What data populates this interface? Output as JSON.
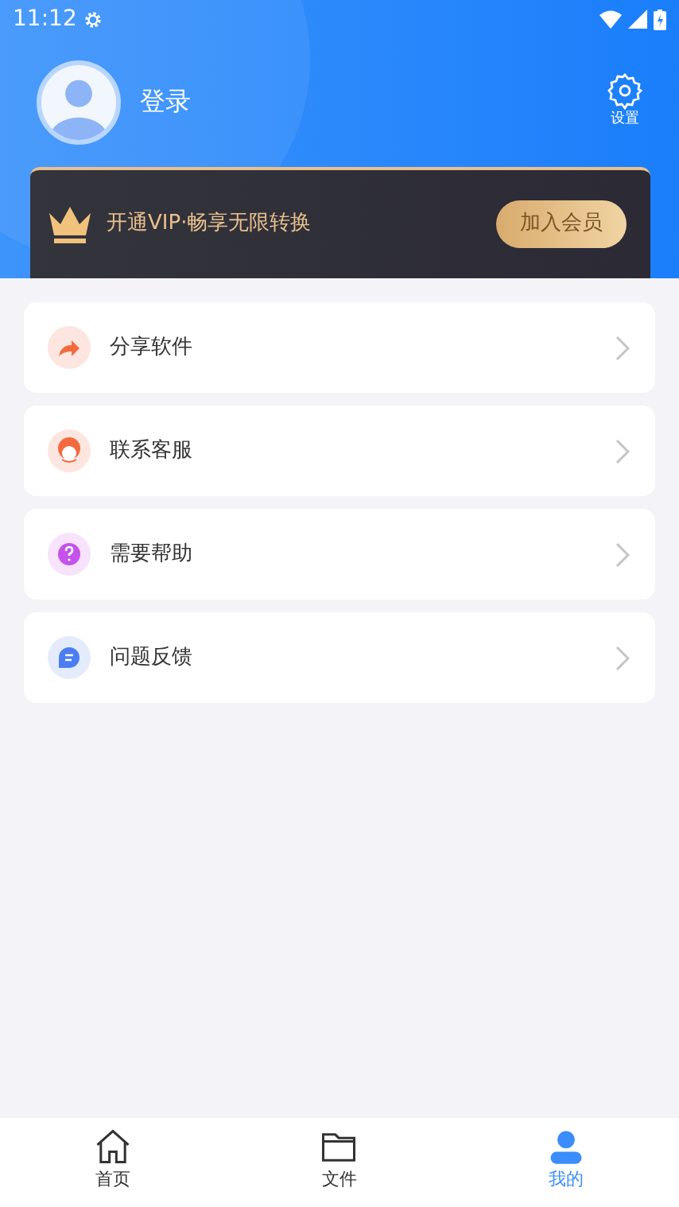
{
  "status_bar": {
    "time": "11:12"
  },
  "profile": {
    "login": "登录",
    "settings": "设置"
  },
  "vip": {
    "text": "开通VIP·畅享无限转换",
    "button": "加入会员"
  },
  "menu": [
    {
      "kind": "share",
      "label": "分享软件"
    },
    {
      "kind": "service",
      "label": "联系客服"
    },
    {
      "kind": "help",
      "label": "需要帮助"
    },
    {
      "kind": "feedback",
      "label": "问题反馈"
    }
  ],
  "tab_bar": [
    {
      "kind": "home",
      "label": "首页",
      "selected": false
    },
    {
      "kind": "files",
      "label": "文件",
      "selected": false
    },
    {
      "kind": "me",
      "label": "我的",
      "selected": true
    }
  ]
}
